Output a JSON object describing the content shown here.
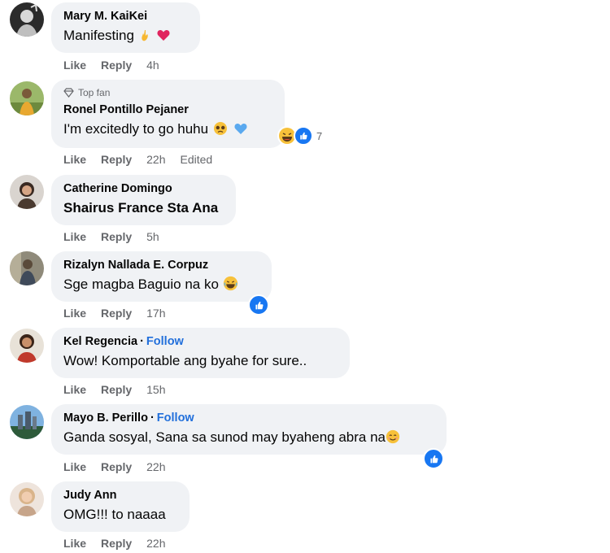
{
  "comments": [
    {
      "name": "Mary M. KaiKei",
      "text": "Manifesting",
      "like": "Like",
      "reply": "Reply",
      "time": "4h"
    },
    {
      "badge": "Top fan",
      "name": "Ronel Pontillo Pejaner",
      "text": "I'm excitedly to go huhu",
      "reaction_count": "7",
      "like": "Like",
      "reply": "Reply",
      "time": "22h",
      "edited": "Edited"
    },
    {
      "name": "Catherine Domingo",
      "text": "Shairus France Sta Ana",
      "like": "Like",
      "reply": "Reply",
      "time": "5h"
    },
    {
      "name": "Rizalyn Nallada E. Corpuz",
      "text": "Sge magba Baguio na ko",
      "like": "Like",
      "reply": "Reply",
      "time": "17h"
    },
    {
      "name": "Kel Regencia",
      "follow": "Follow",
      "text": "Wow! Komportable ang byahe for sure..",
      "like": "Like",
      "reply": "Reply",
      "time": "15h"
    },
    {
      "name": "Mayo B. Perillo",
      "follow": "Follow",
      "text": "Ganda sosyal, Sana sa sunod may byaheng abra na",
      "like": "Like",
      "reply": "Reply",
      "time": "22h"
    },
    {
      "name": "Judy Ann",
      "text": "OMG!!! to naaaa",
      "like": "Like",
      "reply": "Reply",
      "time": "22h"
    }
  ],
  "colors": {
    "bubble": "#f0f2f5",
    "meta": "#65676b",
    "follow": "#216fdb",
    "like_badge": "#1877f2"
  },
  "icons": [
    "crossed-fingers-emoji",
    "red-heart-emoji",
    "pleading-face-emoji",
    "blue-heart-emoji",
    "laughing-emoji",
    "thumbs-up-icon",
    "top-fan-diamond-icon",
    "smiling-face-emoji"
  ]
}
